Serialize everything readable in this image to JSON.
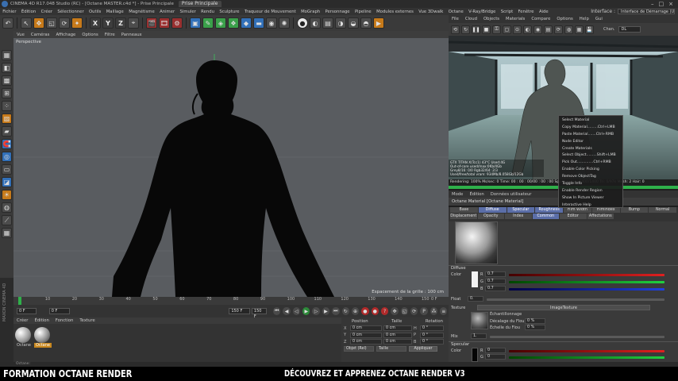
{
  "window": {
    "title": "CINEMA 4D R17.048 Studio (RC) - [Octane MASTER.c4d *] - Prise Principale",
    "tab": "Prise Principale",
    "controls": [
      "–",
      "□",
      "×"
    ]
  },
  "menubar": {
    "items": [
      "Fichier",
      "Édition",
      "Créer",
      "Sélectionner",
      "Outils",
      "Maillage",
      "Magnétisme",
      "Animer",
      "Simuler",
      "Rendu",
      "Sculpture",
      "Traqueur de Mouvement",
      "MoGraph",
      "Personnage",
      "Pipeline",
      "Modules externes",
      "Vue 3Dwalk",
      "Octane",
      "V-Ray/Bridge",
      "Script",
      "Fenêtre",
      "Aide"
    ],
    "layout_label": "Interface :",
    "layout_value": "Interface de Démarrage (Utilisateur)"
  },
  "toolbar": {
    "xyz": [
      "X",
      "Y",
      "Z"
    ]
  },
  "viewport": {
    "menu": [
      "Vue",
      "Caméras",
      "Affichage",
      "Options",
      "Filtre",
      "Panneaux"
    ],
    "label": "Perspective",
    "grid_spacing": "Espacement de la grille : 100 cm",
    "colors": {
      "bg": "#595c60",
      "silhouette": "#080808"
    }
  },
  "timeline": {
    "ticks": [
      "0",
      "10",
      "20",
      "30",
      "40",
      "50",
      "60",
      "70",
      "80",
      "90",
      "100",
      "110",
      "120",
      "130",
      "140",
      "150"
    ],
    "frame_end": "0 F"
  },
  "playbar": {
    "start_field": "0 F",
    "current_field": "0 F",
    "end_field": "150 F",
    "end_field2": "150 F"
  },
  "material_manager": {
    "menu": [
      "Créer",
      "Édition",
      "Fonction",
      "Texture"
    ],
    "materials": [
      {
        "name": "Octane",
        "color": "#dcdcdc"
      },
      {
        "name": "Octane",
        "color": "#c9a060"
      }
    ]
  },
  "coords": {
    "headers": [
      "Position",
      "Taille",
      "Rotation"
    ],
    "rows": [
      {
        "axis": "X",
        "pos": "0 cm",
        "size": "0 cm",
        "rot_axis": "H",
        "rot": "0 °"
      },
      {
        "axis": "Y",
        "pos": "0 cm",
        "size": "0 cm",
        "rot_axis": "P",
        "rot": "0 °"
      },
      {
        "axis": "Z",
        "pos": "0 cm",
        "size": "0 cm",
        "rot_axis": "B",
        "rot": "0 °"
      }
    ],
    "mode1": "Objet (Rel)",
    "mode2": "Taille",
    "apply": "Appliquer"
  },
  "octane_viewer": {
    "menu": [
      "File",
      "Cloud",
      "Objects",
      "Materials",
      "Compare",
      "Options",
      "Help",
      "Gui"
    ],
    "channel_label": "Chan.",
    "channel_value": "DL",
    "stats": [
      "GTX TITAN X(Tcc1) 43°C Used:4G",
      "Out-of-core used/max:0Kb/4Gb",
      "Grey8/16: 0/0      Rgb32/64: 2/3",
      "Used/free/total vram: 934Mb/8.058Gb/12Gb"
    ],
    "status": "Rendering: 100%   Ms/sec: 0   Time: 00 : 00 : 00/00 : 00 : 00   Spp/maxspp: 1400/1400   Tri: 0/97k   Mesh: 2   Hair: 0",
    "progress": 1.0,
    "context_menu": [
      "Select Material",
      "Copy Material.........Ctrl+LMB",
      "Paste Material.......Ctrl+RMB",
      "Node Editor",
      "Create Materials",
      "Select Object.........Shift+LMB",
      "Pick Out..............Ctrl+RMB",
      "Enable Color Picking",
      "Remove ObjectTag",
      "Toggle Info",
      "Enable Render Region",
      "Show In Picture Viewer",
      "Interactive Help"
    ]
  },
  "attributes": {
    "menu": [
      "Mode",
      "Édition",
      "Données utilisateur"
    ],
    "title": "Octane Material [Octane Material]",
    "tabs_row1": [
      "Base",
      "Diffuse",
      "Specular",
      "Roughness",
      "Film Width",
      "Filmindex",
      "Bump",
      "Normal"
    ],
    "tabs_row2": [
      "Displacement",
      "Opacity",
      "Index",
      "Common",
      "Editor",
      "Affectations"
    ],
    "tabs_row1_active": [
      "Diffuse",
      "Specular",
      "Roughness"
    ],
    "tabs_row2_active": [
      "Common"
    ],
    "diffuse": {
      "label": "Diffuse",
      "color_label": "Color",
      "r": "0.7",
      "g": "0.7",
      "b": "0.7",
      "float_label": "Float",
      "float_value": "0.",
      "texture_label": "Texture",
      "texture_button": "ImageTexture",
      "sampling_label": "Échantillonnage",
      "blur_label": "Décalage du Flou",
      "blur_value": "0 %",
      "blur_scale_label": "Échelle du Flou",
      "blur_scale_value": "0 %",
      "mix_label": "Mix",
      "mix_value": "1."
    },
    "specular": {
      "label": "Specular",
      "color_label": "Color",
      "r": "0",
      "g": "0",
      "b": "0"
    }
  },
  "footer": {
    "status": "Octane:",
    "left_text": "FORMATION OCTANE RENDER",
    "right_text": "DÉCOUVREZ ET APPRENEZ OCTANE RENDER V3"
  },
  "brand": {
    "left_vertical": "MAXON CINEMA 4D"
  }
}
